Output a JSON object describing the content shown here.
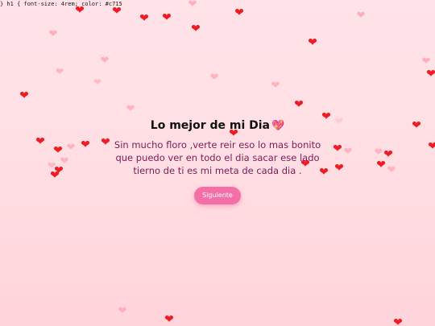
{
  "css_leak_text": "} h1 { font-size: 4rem; color: #c715",
  "title": {
    "text": "Lo mejor de mi Dia",
    "emoji_icon": "sparkling-heart-icon",
    "emoji_glyph": "💖"
  },
  "message": "Sin mucho floro ,verte reir eso lo mas bonito que puedo ver en todo el dia sacar ese lado tierno de ti es mi meta de cada dia .",
  "button": {
    "label": "Siguiente",
    "color": "#f36fa8"
  },
  "hearts": {
    "icon": "heart-icon",
    "glyph": "❤",
    "colors": {
      "red": "#ee1c25",
      "pink": "#ffaab4",
      "soft_pink": "#ffc4cc"
    }
  },
  "colors": {
    "background": "#ffe0e6",
    "title": "#111111",
    "message": "#7a1a5c"
  }
}
